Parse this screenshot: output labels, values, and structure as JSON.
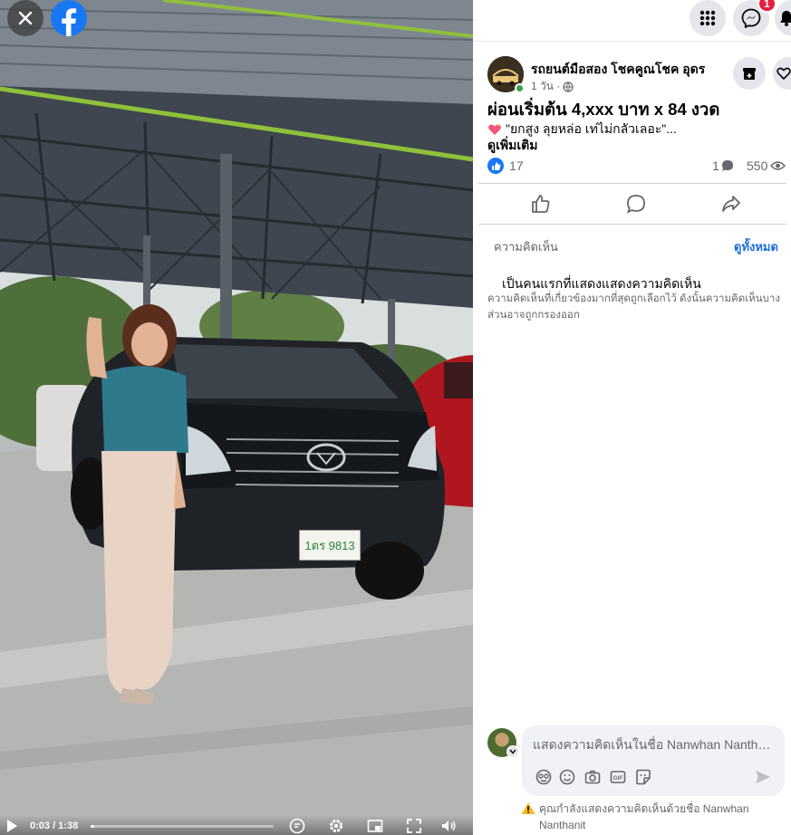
{
  "video": {
    "time_label": "0:03 / 1:38",
    "progress_fraction": 0.02,
    "plate_text": "1ตร 9813"
  },
  "topbar": {
    "notification_count": "1"
  },
  "post": {
    "page_name": "รถยนต์มือสอง โชคคูณโชค อุดร",
    "time": "1 วัน ·",
    "title": "ผ่อนเริ่มต้น 4,xxx บาท x 84 งวด",
    "subtitle": "\"ยกสูง ลุยหล่อ เท่ไม่กลัวเลอะ\"...",
    "see_more": "ดูเพิ่มเติม",
    "likes": "17",
    "comments": "1",
    "views": "550"
  },
  "comments": {
    "label": "ความคิดเห็น",
    "see_all": "ดูทั้งหมด",
    "empty_title": "เป็นคนแรกที่แสดงแสดงความคิดเห็น",
    "empty_desc": "ความคิดเห็นที่เกี่ยวข้องมากที่สุดถูกเลือกไว้ ดังนั้นความคิดเห็นบางส่วนอาจถูกกรองออก"
  },
  "composer": {
    "placeholder": "แสดงความคิดเห็นในชื่อ Nanwhan Nanthanit",
    "warning": "คุณกำลังแสดงความคิดเห็นด้วยชื่อ Nanwhan Nanthanit"
  },
  "colors": {
    "facebook_blue": "#1877f2",
    "link_blue": "#216fdb",
    "badge_red": "#e41e3f"
  }
}
